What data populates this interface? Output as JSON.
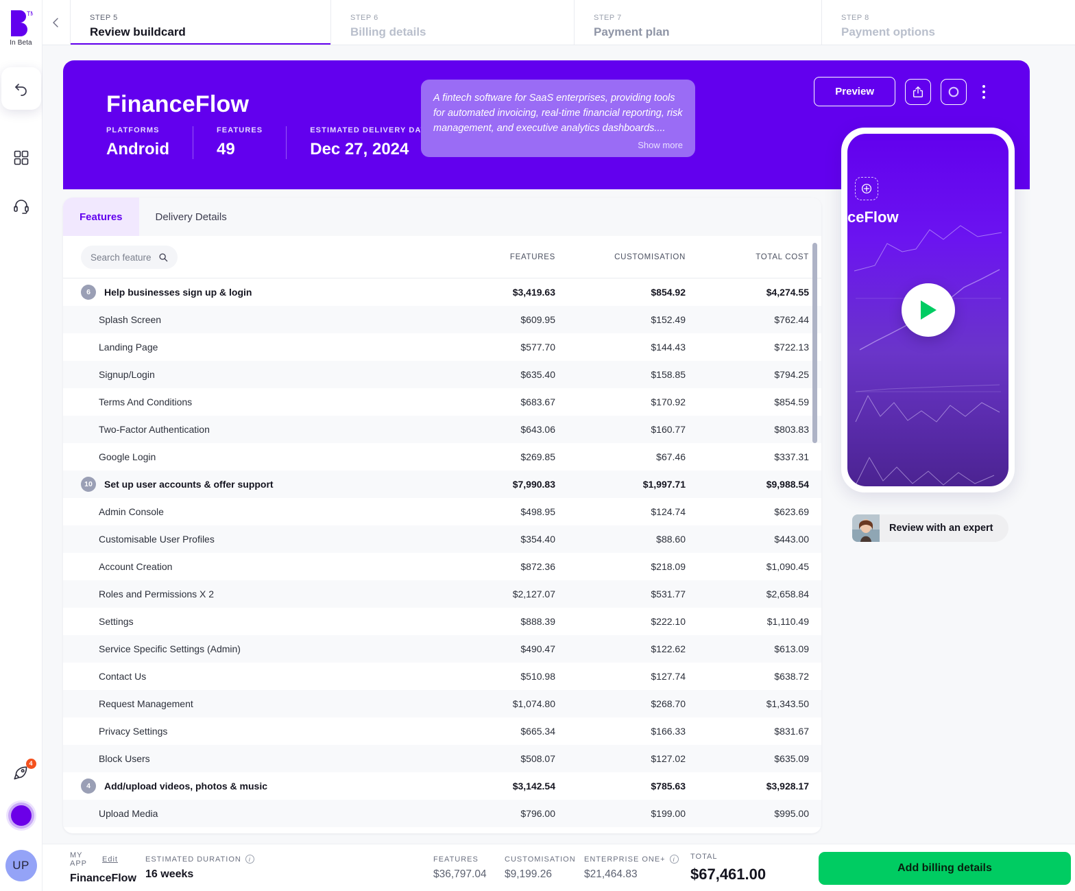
{
  "rail": {
    "logo_beta": "In Beta",
    "undo_icon": "undo-icon",
    "grid_icon": "grid-icon",
    "headset_icon": "headset-icon",
    "rocket_icon": "rocket-icon",
    "rocket_badge": "4",
    "user_initials": "UP"
  },
  "steps": [
    {
      "num": "STEP 5",
      "name": "Review buildcard",
      "active": true
    },
    {
      "num": "STEP 6",
      "name": "Billing details",
      "active": false
    },
    {
      "num": "STEP 7",
      "name": "Payment plan",
      "active": false
    },
    {
      "num": "STEP 8",
      "name": "Payment options",
      "active": false
    }
  ],
  "hero": {
    "title": "FinanceFlow",
    "stats": [
      {
        "label": "PLATFORMS",
        "value": "Android"
      },
      {
        "label": "FEATURES",
        "value": "49"
      },
      {
        "label": "ESTIMATED DELIVERY DATE",
        "value": "Dec 27, 2024"
      }
    ],
    "description": "A fintech software for SaaS enterprises, providing tools for automated invoicing, real-time financial reporting, risk management, and executive analytics dashboards....",
    "show_more": "Show more",
    "preview_label": "Preview",
    "share_icon": "share-icon",
    "record_icon": "record-circle-icon",
    "kebab_icon": "more-vertical-icon",
    "accent": "#6200ee"
  },
  "card": {
    "tabs": [
      {
        "label": "Features",
        "active": true
      },
      {
        "label": "Delivery Details",
        "active": false
      }
    ],
    "search_placeholder": "Search feature",
    "search_icon": "search-icon",
    "columns": [
      "FEATURES",
      "CUSTOMISATION",
      "TOTAL COST"
    ],
    "rows": [
      {
        "type": "group",
        "count": "6",
        "name": "Help businesses sign up & login",
        "features": "$3,419.63",
        "customisation": "$854.92",
        "total": "$4,274.55"
      },
      {
        "type": "item",
        "name": "Splash Screen",
        "features": "$609.95",
        "customisation": "$152.49",
        "total": "$762.44"
      },
      {
        "type": "item",
        "name": "Landing Page",
        "features": "$577.70",
        "customisation": "$144.43",
        "total": "$722.13"
      },
      {
        "type": "item",
        "name": "Signup/Login",
        "features": "$635.40",
        "customisation": "$158.85",
        "total": "$794.25"
      },
      {
        "type": "item",
        "name": "Terms And Conditions",
        "features": "$683.67",
        "customisation": "$170.92",
        "total": "$854.59"
      },
      {
        "type": "item",
        "name": "Two-Factor Authentication",
        "features": "$643.06",
        "customisation": "$160.77",
        "total": "$803.83"
      },
      {
        "type": "item",
        "name": "Google Login",
        "features": "$269.85",
        "customisation": "$67.46",
        "total": "$337.31"
      },
      {
        "type": "group",
        "count": "10",
        "name": "Set up user accounts & offer support",
        "features": "$7,990.83",
        "customisation": "$1,997.71",
        "total": "$9,988.54"
      },
      {
        "type": "item",
        "name": "Admin Console",
        "features": "$498.95",
        "customisation": "$124.74",
        "total": "$623.69"
      },
      {
        "type": "item",
        "name": "Customisable User Profiles",
        "features": "$354.40",
        "customisation": "$88.60",
        "total": "$443.00"
      },
      {
        "type": "item",
        "name": "Account Creation",
        "features": "$872.36",
        "customisation": "$218.09",
        "total": "$1,090.45"
      },
      {
        "type": "item",
        "name": "Roles and Permissions X 2",
        "features": "$2,127.07",
        "customisation": "$531.77",
        "total": "$2,658.84"
      },
      {
        "type": "item",
        "name": "Settings",
        "features": "$888.39",
        "customisation": "$222.10",
        "total": "$1,110.49"
      },
      {
        "type": "item",
        "name": "Service Specific Settings (Admin)",
        "features": "$490.47",
        "customisation": "$122.62",
        "total": "$613.09"
      },
      {
        "type": "item",
        "name": "Contact Us",
        "features": "$510.98",
        "customisation": "$127.74",
        "total": "$638.72"
      },
      {
        "type": "item",
        "name": "Request Management",
        "features": "$1,074.80",
        "customisation": "$268.70",
        "total": "$1,343.50"
      },
      {
        "type": "item",
        "name": "Privacy Settings",
        "features": "$665.34",
        "customisation": "$166.33",
        "total": "$831.67"
      },
      {
        "type": "item",
        "name": "Block Users",
        "features": "$508.07",
        "customisation": "$127.02",
        "total": "$635.09"
      },
      {
        "type": "group",
        "count": "4",
        "name": "Add/upload videos, photos & music",
        "features": "$3,142.54",
        "customisation": "$785.63",
        "total": "$3,928.17"
      },
      {
        "type": "item",
        "name": "Upload Media",
        "features": "$796.00",
        "customisation": "$199.00",
        "total": "$995.00"
      }
    ]
  },
  "preview": {
    "app_name": "ceFlow",
    "add_icon": "plus-in-box-icon",
    "play_icon": "play-icon",
    "expert_label": "Review with an expert",
    "expert_avatar": "expert-avatar-photo"
  },
  "footer": {
    "my_app_label": "MY APP",
    "edit_label": "Edit",
    "my_app_value": "FinanceFlow",
    "duration_label": "ESTIMATED DURATION",
    "duration_value": "16 weeks",
    "features_label": "FEATURES",
    "features_value": "$36,797.04",
    "customisation_label": "CUSTOMISATION",
    "customisation_value": "$9,199.26",
    "enterprise_label": "ENTERPRISE ONE+",
    "enterprise_value": "$21,464.83",
    "total_label": "TOTAL",
    "total_value": "$67,461.00",
    "cta_label": "Add billing details",
    "cta_color": "#00cc62"
  }
}
